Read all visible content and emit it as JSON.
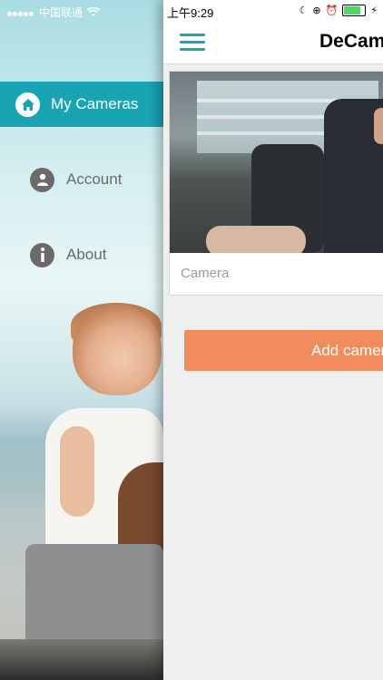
{
  "status_bar": {
    "carrier": "中国联通",
    "time": "上午9:29"
  },
  "sidebar": {
    "items": [
      {
        "label": "My Cameras",
        "icon": "home-icon",
        "active": true
      },
      {
        "label": "Account",
        "icon": "user-icon",
        "active": false
      },
      {
        "label": "About",
        "icon": "info-icon",
        "active": false
      }
    ]
  },
  "header": {
    "title": "DeCam"
  },
  "camera_card": {
    "label": "Camera"
  },
  "add_button": {
    "label": "Add camera"
  },
  "colors": {
    "accent": "#1aa3b3",
    "add_button": "#f08c5e",
    "panel_bg": "#efefef"
  }
}
